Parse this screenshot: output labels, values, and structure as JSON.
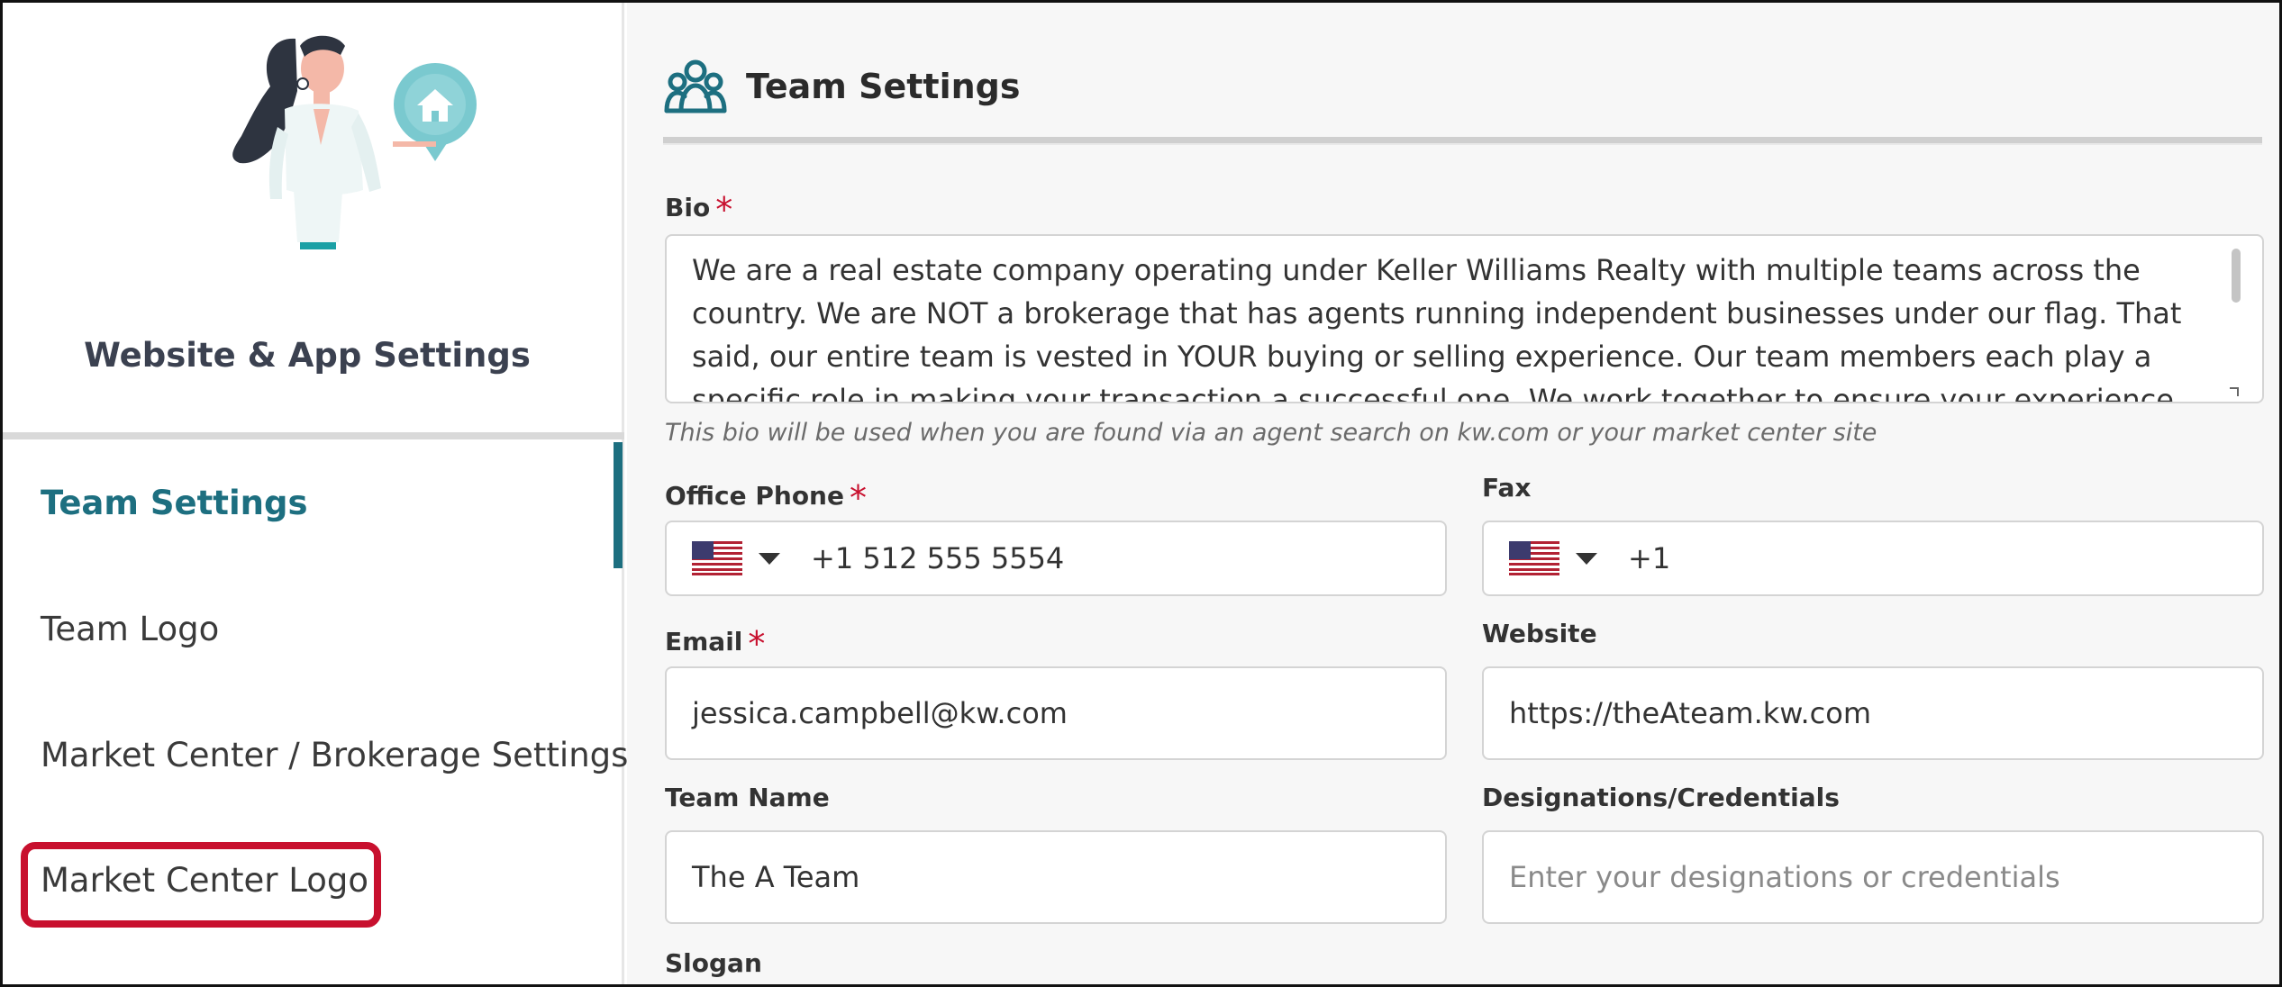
{
  "sidebar": {
    "title": "Website & App Settings",
    "items": [
      {
        "label": "Team Settings",
        "active": true
      },
      {
        "label": "Team Logo",
        "active": false
      },
      {
        "label": "Market Center / Brokerage Settings",
        "active": false
      },
      {
        "label": "Market Center Logo",
        "active": false,
        "highlighted": true
      }
    ]
  },
  "header": {
    "title": "Team Settings",
    "icon": "team-icon"
  },
  "form": {
    "bio": {
      "label": "Bio",
      "required_mark": "*",
      "value": "We are a real estate company operating under Keller Williams Realty with multiple teams across the country. We are NOT a brokerage that has agents running independent businesses under our flag. That said, our entire team is vested in YOUR buying or selling experience. Our team members each play a specific role in making your transaction a successful one. We work together to ensure your experience exceeds expectations.",
      "helper": "This bio will be used when you are found via an agent search on kw.com or your market center site"
    },
    "office_phone": {
      "label": "Office Phone",
      "required_mark": "*",
      "country": "us-flag-icon",
      "value": "+1 512 555 5554"
    },
    "fax": {
      "label": "Fax",
      "country": "us-flag-icon",
      "value": "+1"
    },
    "email": {
      "label": "Email",
      "required_mark": "*",
      "value": "jessica.campbell@kw.com"
    },
    "website": {
      "label": "Website",
      "value": "https://theAteam.kw.com"
    },
    "team_name": {
      "label": "Team Name",
      "value": "The A Team"
    },
    "designations": {
      "label": "Designations/Credentials",
      "placeholder": "Enter your designations or credentials"
    },
    "slogan": {
      "label": "Slogan"
    }
  },
  "colors": {
    "accent": "#1d6f80",
    "required": "#c8102e",
    "highlight": "#c8102e",
    "illustration_teal": "#7ac9cf"
  }
}
